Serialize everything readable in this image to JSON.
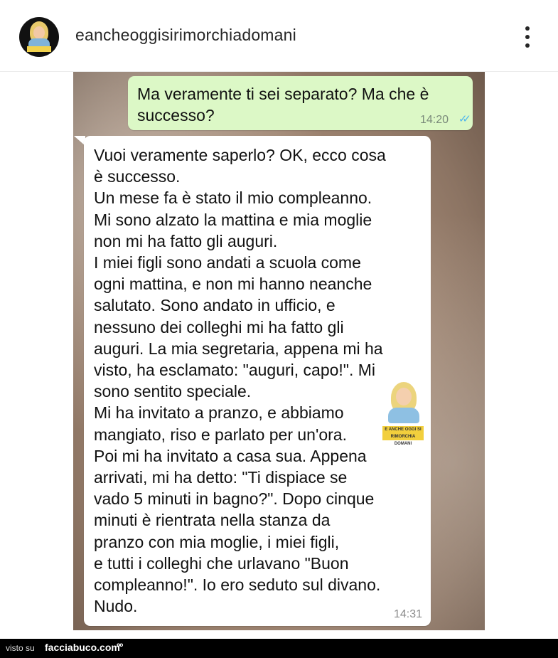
{
  "header": {
    "username": "eancheoggisirimorchiadomani",
    "avatar_icon": "avatar-icon",
    "more_icon": "more-vertical-icon"
  },
  "chat": {
    "outgoing": {
      "text": "Ma veramente ti sei separato? Ma che è successo?",
      "time": "14:20",
      "status_icon": "double-check-read-icon",
      "status_color": "#4fb6ec"
    },
    "incoming": {
      "lines": [
        "Vuoi veramente saperlo? OK, ecco cosa",
        "è successo.",
        "Un mese fa è stato il mio compleanno.",
        "Mi sono alzato la mattina e mia moglie",
        "non mi ha fatto gli auguri.",
        "I miei figli sono andati a scuola come",
        "ogni mattina, e non mi hanno neanche",
        "salutato. Sono andato in ufficio, e",
        "nessuno dei colleghi mi ha fatto gli",
        "auguri. La mia segretaria, appena mi ha",
        "visto, ha esclamato: \"auguri, capo!\". Mi",
        "sono sentito speciale.",
        "Mi ha invitato a pranzo, e abbiamo",
        "mangiato, riso e parlato per un'ora.",
        "Poi mi ha invitato a casa sua. Appena",
        "arrivati, mi ha detto: \"Ti dispiace se",
        "vado 5 minuti in bagno?\". Dopo cinque",
        "minuti è rientrata nella stanza da",
        "pranzo con mia moglie, i miei figli,",
        "e tutti i colleghi che urlavano \"Buon",
        "compleanno!\". Io ero seduto sul divano.",
        "Nudo."
      ],
      "time": "14:31"
    },
    "sticker_text": "E ANCHE OGGI SI RIMORCHIA DOMANI"
  },
  "footer": {
    "visto_su": "visto su",
    "brand": "facciabuco.com",
    "eyes_icon": "eyes-icon"
  },
  "colors": {
    "outgoing_bubble": "#dcf8c6",
    "incoming_bubble": "#ffffff",
    "footer_bg": "#000000"
  }
}
